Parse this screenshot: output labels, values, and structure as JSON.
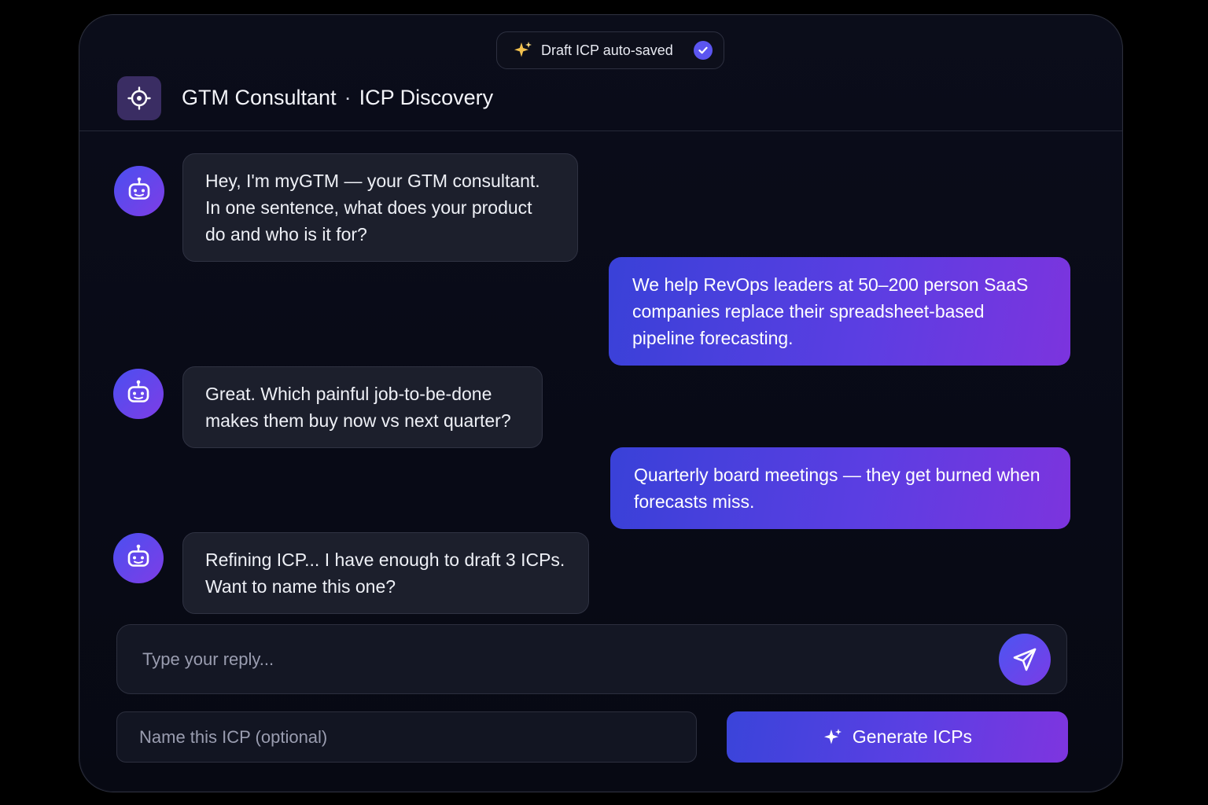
{
  "toast": {
    "text": "Draft ICP auto-saved",
    "icon": "sparkle-icon",
    "status_icon": "check-icon"
  },
  "header": {
    "title": "GTM Consultant",
    "separator": "·",
    "subtitle": "ICP Discovery",
    "icon": "target-icon"
  },
  "messages": [
    {
      "role": "bot",
      "text": "Hey, I'm myGTM — your GTM consultant. In one sentence, what does your product do and who is it for?"
    },
    {
      "role": "user",
      "text": "We help RevOps leaders at 50–200 person SaaS companies replace their spreadsheet-based pipeline forecasting."
    },
    {
      "role": "bot",
      "text": "Great. Which painful job-to-be-done makes them buy now vs next quarter?"
    },
    {
      "role": "user",
      "text": "Quarterly board meetings — they get burned when forecasts miss."
    },
    {
      "role": "bot",
      "text": "Refining ICP... I have enough to draft 3 ICPs. Want to name this one?"
    }
  ],
  "composer": {
    "placeholder": "Type your reply...",
    "value": "",
    "send_icon": "send-icon"
  },
  "icp_name": {
    "placeholder": "Name this ICP (optional)",
    "value": ""
  },
  "generate": {
    "label": "Generate ICPs",
    "icon": "sparkle-icon"
  },
  "colors": {
    "accent_start": "#3941d8",
    "accent_end": "#7c34de",
    "background": "#080a16",
    "bot_bubble": "#1c1f2c"
  }
}
